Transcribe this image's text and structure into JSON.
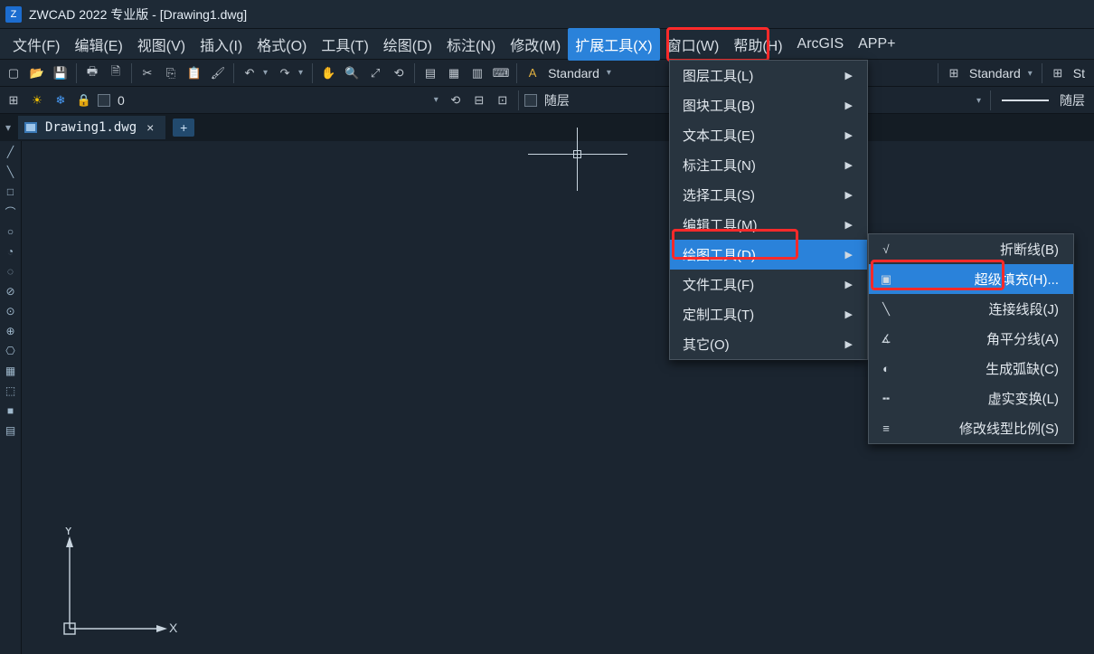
{
  "title": "ZWCAD 2022 专业版 - [Drawing1.dwg]",
  "menubar": {
    "items": [
      "文件(F)",
      "编辑(E)",
      "视图(V)",
      "插入(I)",
      "格式(O)",
      "工具(T)",
      "绘图(D)",
      "标注(N)",
      "修改(M)",
      "扩展工具(X)",
      "窗口(W)",
      "帮助(H)",
      "ArcGIS",
      "APP+"
    ],
    "active_index": 9
  },
  "toolbar1": {
    "style_label": "Standard",
    "style_label_right": "Standard",
    "right_extra": "St"
  },
  "toolbar2": {
    "layer_name": "0",
    "bylayer_label_1": "随层",
    "bylayer_label_2": "随层"
  },
  "tab": {
    "name": "Drawing1.dwg"
  },
  "left_tools": [
    "╱",
    "╲",
    "□",
    "⌒",
    "○",
    "◔",
    "◌",
    "⊘",
    "⊙",
    "⊕",
    "⎔",
    "▦",
    "⬚",
    "■",
    "▤"
  ],
  "dropdown1": {
    "items": [
      {
        "label": "图层工具(L)",
        "arrow": true
      },
      {
        "label": "图块工具(B)",
        "arrow": true
      },
      {
        "label": "文本工具(E)",
        "arrow": true
      },
      {
        "label": "标注工具(N)",
        "arrow": true
      },
      {
        "label": "选择工具(S)",
        "arrow": true
      },
      {
        "label": "编辑工具(M)",
        "arrow": true
      },
      {
        "label": "绘图工具(D)",
        "arrow": true,
        "hover": true
      },
      {
        "label": "文件工具(F)",
        "arrow": true
      },
      {
        "label": "定制工具(T)",
        "arrow": true
      },
      {
        "label": "其它(O)",
        "arrow": true
      }
    ]
  },
  "dropdown2": {
    "items": [
      {
        "icon": "√",
        "label": "折断线(B)"
      },
      {
        "icon": "▣",
        "label": "超级填充(H)...",
        "hover": true
      },
      {
        "icon": "╲",
        "label": "连接线段(J)"
      },
      {
        "icon": "∡",
        "label": "角平分线(A)"
      },
      {
        "icon": "◐",
        "label": "生成弧缺(C)"
      },
      {
        "icon": "╍",
        "label": "虚实变换(L)"
      },
      {
        "icon": "≡",
        "label": "修改线型比例(S)"
      }
    ]
  },
  "ucs": {
    "x_label": "X",
    "y_label": "Y"
  }
}
